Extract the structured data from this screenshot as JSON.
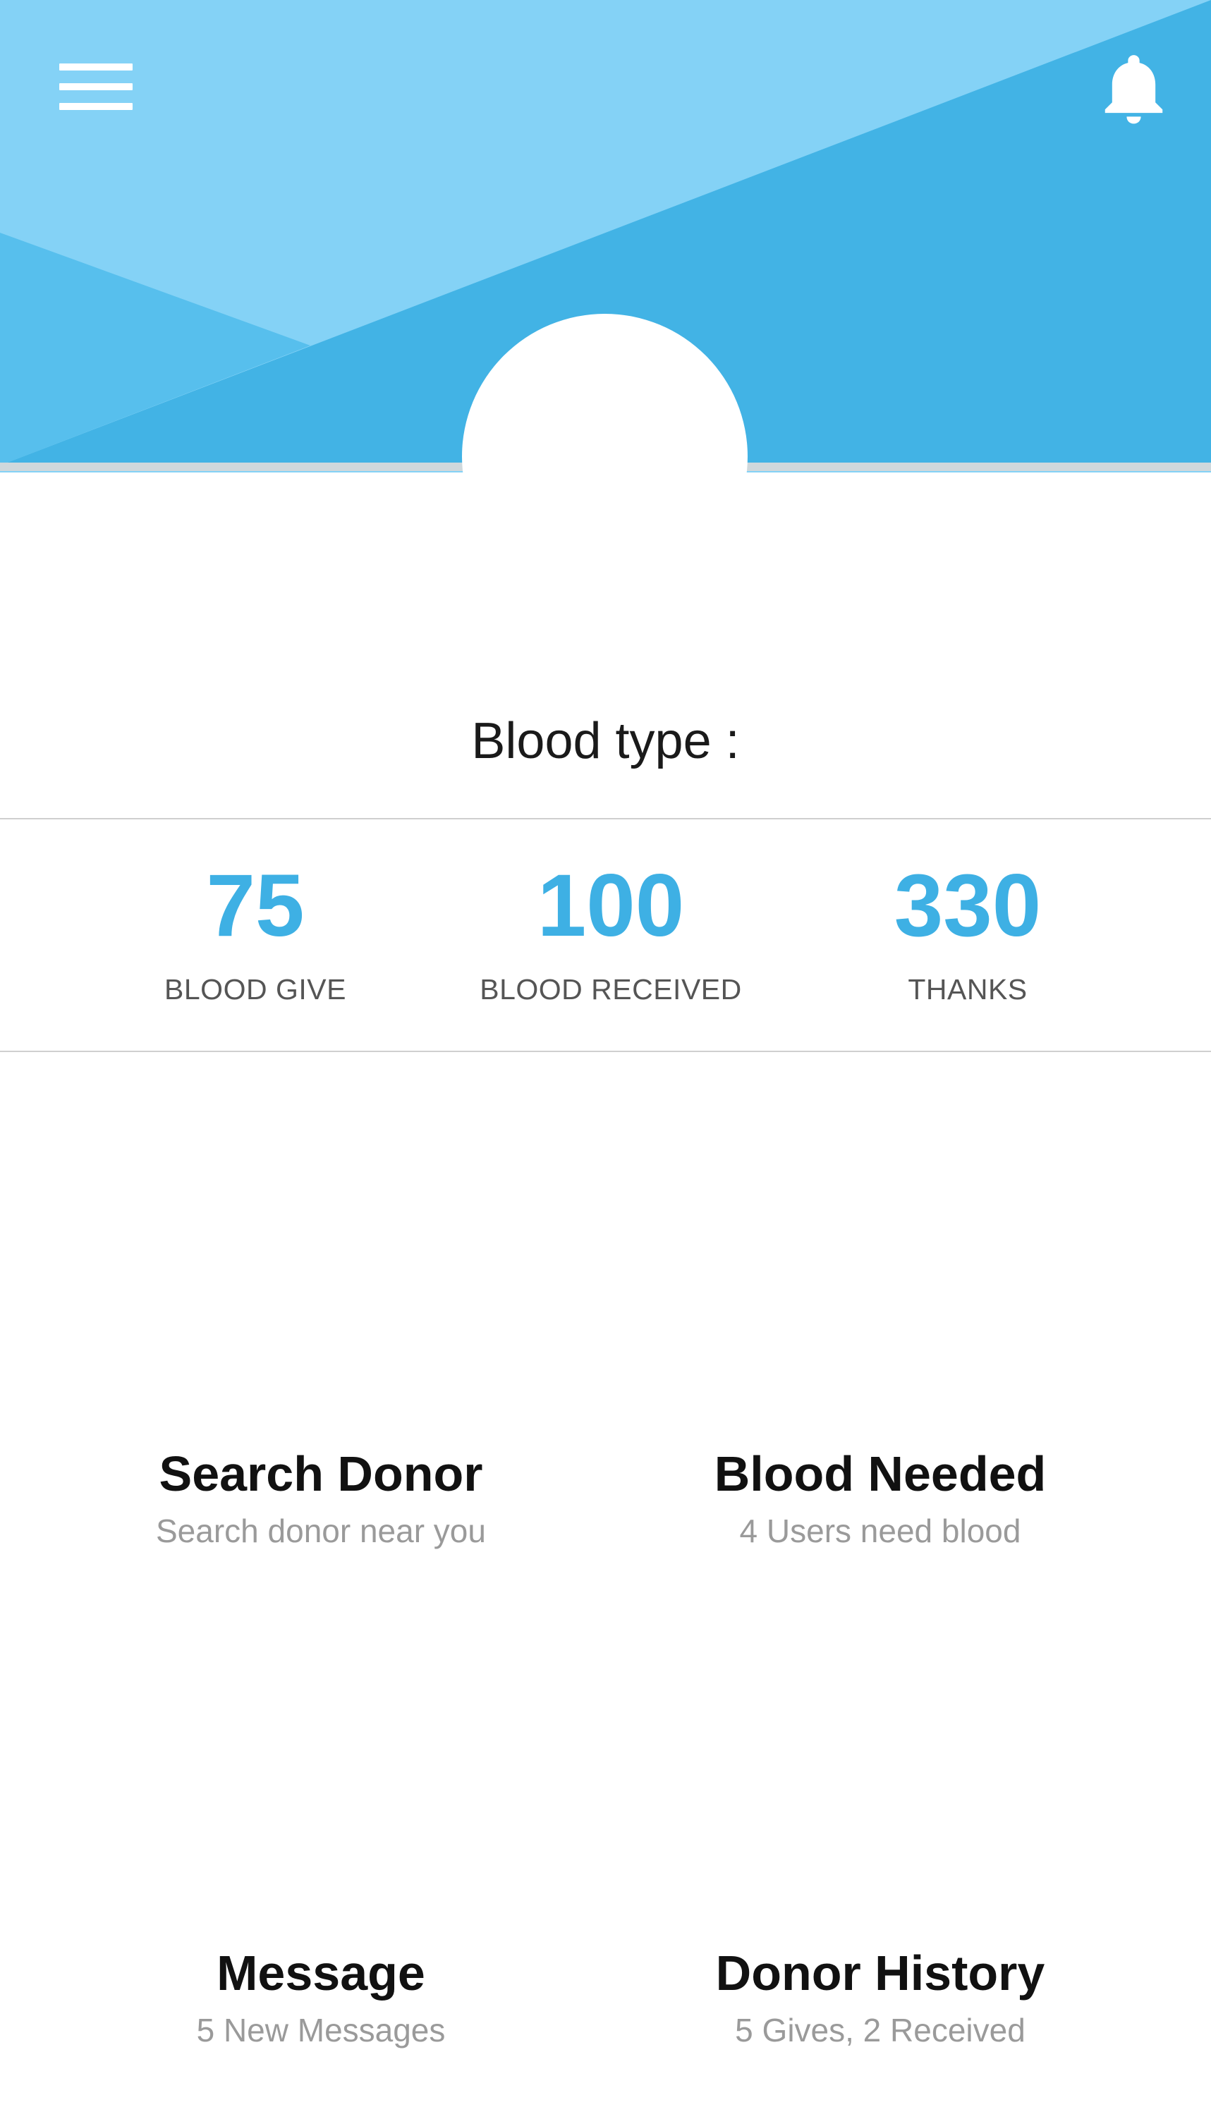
{
  "colors": {
    "header_light": "#84d2f6",
    "header_dark": "#42b3e5",
    "header_mid": "#57bfed",
    "header_bottom_line": "#c9d9e0",
    "accent": "#3eb0e4"
  },
  "header": {
    "menu_icon": "hamburger-menu-icon",
    "notification_icon": "bell-icon"
  },
  "profile": {
    "blood_type_label": "Blood type :"
  },
  "stats": [
    {
      "value": "75",
      "label": "BLOOD GIVE"
    },
    {
      "value": "100",
      "label": "BLOOD RECEIVED"
    },
    {
      "value": "330",
      "label": "THANKS"
    }
  ],
  "tiles": [
    {
      "title": "Search Donor",
      "subtitle": "Search donor near you"
    },
    {
      "title": "Blood Needed",
      "subtitle": "4 Users need blood"
    },
    {
      "title": "Message",
      "subtitle": "5 New Messages"
    },
    {
      "title": "Donor History",
      "subtitle": "5 Gives, 2 Received"
    }
  ]
}
